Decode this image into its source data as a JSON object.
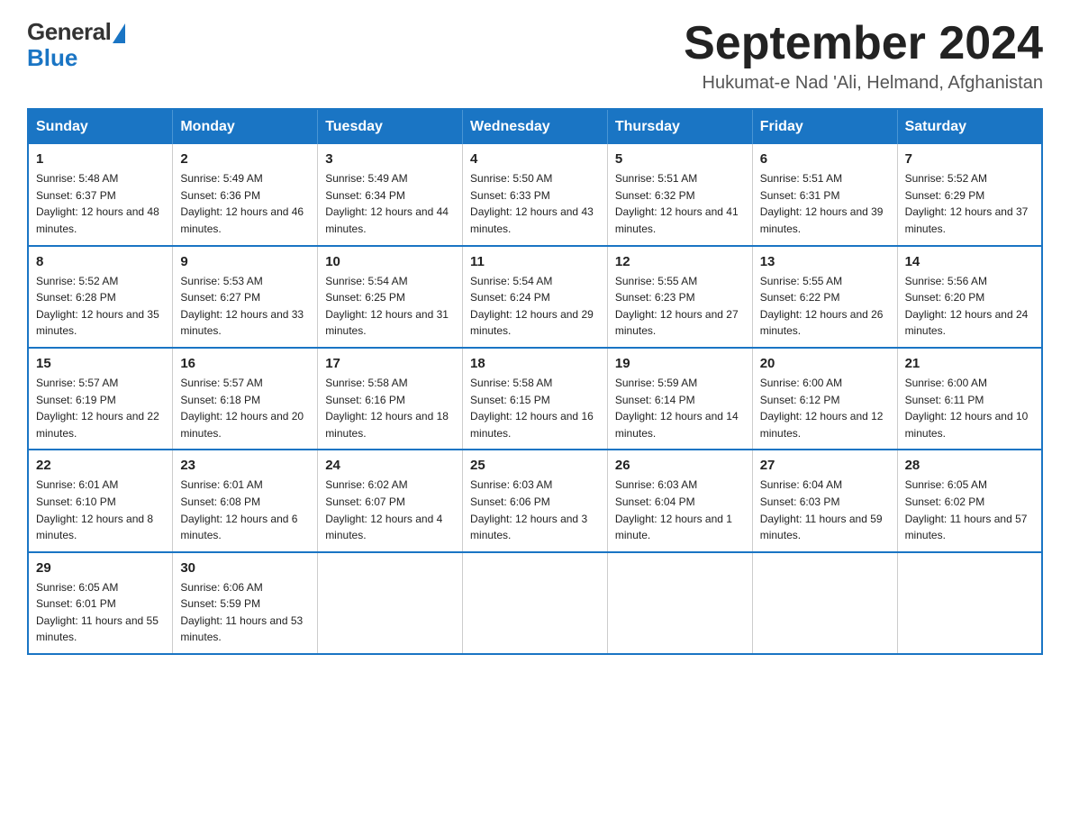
{
  "logo": {
    "general_text": "General",
    "blue_text": "Blue"
  },
  "title": {
    "month_year": "September 2024",
    "location": "Hukumat-e Nad 'Ali, Helmand, Afghanistan"
  },
  "weekdays": [
    "Sunday",
    "Monday",
    "Tuesday",
    "Wednesday",
    "Thursday",
    "Friday",
    "Saturday"
  ],
  "weeks": [
    [
      {
        "day": "1",
        "sunrise": "Sunrise: 5:48 AM",
        "sunset": "Sunset: 6:37 PM",
        "daylight": "Daylight: 12 hours and 48 minutes."
      },
      {
        "day": "2",
        "sunrise": "Sunrise: 5:49 AM",
        "sunset": "Sunset: 6:36 PM",
        "daylight": "Daylight: 12 hours and 46 minutes."
      },
      {
        "day": "3",
        "sunrise": "Sunrise: 5:49 AM",
        "sunset": "Sunset: 6:34 PM",
        "daylight": "Daylight: 12 hours and 44 minutes."
      },
      {
        "day": "4",
        "sunrise": "Sunrise: 5:50 AM",
        "sunset": "Sunset: 6:33 PM",
        "daylight": "Daylight: 12 hours and 43 minutes."
      },
      {
        "day": "5",
        "sunrise": "Sunrise: 5:51 AM",
        "sunset": "Sunset: 6:32 PM",
        "daylight": "Daylight: 12 hours and 41 minutes."
      },
      {
        "day": "6",
        "sunrise": "Sunrise: 5:51 AM",
        "sunset": "Sunset: 6:31 PM",
        "daylight": "Daylight: 12 hours and 39 minutes."
      },
      {
        "day": "7",
        "sunrise": "Sunrise: 5:52 AM",
        "sunset": "Sunset: 6:29 PM",
        "daylight": "Daylight: 12 hours and 37 minutes."
      }
    ],
    [
      {
        "day": "8",
        "sunrise": "Sunrise: 5:52 AM",
        "sunset": "Sunset: 6:28 PM",
        "daylight": "Daylight: 12 hours and 35 minutes."
      },
      {
        "day": "9",
        "sunrise": "Sunrise: 5:53 AM",
        "sunset": "Sunset: 6:27 PM",
        "daylight": "Daylight: 12 hours and 33 minutes."
      },
      {
        "day": "10",
        "sunrise": "Sunrise: 5:54 AM",
        "sunset": "Sunset: 6:25 PM",
        "daylight": "Daylight: 12 hours and 31 minutes."
      },
      {
        "day": "11",
        "sunrise": "Sunrise: 5:54 AM",
        "sunset": "Sunset: 6:24 PM",
        "daylight": "Daylight: 12 hours and 29 minutes."
      },
      {
        "day": "12",
        "sunrise": "Sunrise: 5:55 AM",
        "sunset": "Sunset: 6:23 PM",
        "daylight": "Daylight: 12 hours and 27 minutes."
      },
      {
        "day": "13",
        "sunrise": "Sunrise: 5:55 AM",
        "sunset": "Sunset: 6:22 PM",
        "daylight": "Daylight: 12 hours and 26 minutes."
      },
      {
        "day": "14",
        "sunrise": "Sunrise: 5:56 AM",
        "sunset": "Sunset: 6:20 PM",
        "daylight": "Daylight: 12 hours and 24 minutes."
      }
    ],
    [
      {
        "day": "15",
        "sunrise": "Sunrise: 5:57 AM",
        "sunset": "Sunset: 6:19 PM",
        "daylight": "Daylight: 12 hours and 22 minutes."
      },
      {
        "day": "16",
        "sunrise": "Sunrise: 5:57 AM",
        "sunset": "Sunset: 6:18 PM",
        "daylight": "Daylight: 12 hours and 20 minutes."
      },
      {
        "day": "17",
        "sunrise": "Sunrise: 5:58 AM",
        "sunset": "Sunset: 6:16 PM",
        "daylight": "Daylight: 12 hours and 18 minutes."
      },
      {
        "day": "18",
        "sunrise": "Sunrise: 5:58 AM",
        "sunset": "Sunset: 6:15 PM",
        "daylight": "Daylight: 12 hours and 16 minutes."
      },
      {
        "day": "19",
        "sunrise": "Sunrise: 5:59 AM",
        "sunset": "Sunset: 6:14 PM",
        "daylight": "Daylight: 12 hours and 14 minutes."
      },
      {
        "day": "20",
        "sunrise": "Sunrise: 6:00 AM",
        "sunset": "Sunset: 6:12 PM",
        "daylight": "Daylight: 12 hours and 12 minutes."
      },
      {
        "day": "21",
        "sunrise": "Sunrise: 6:00 AM",
        "sunset": "Sunset: 6:11 PM",
        "daylight": "Daylight: 12 hours and 10 minutes."
      }
    ],
    [
      {
        "day": "22",
        "sunrise": "Sunrise: 6:01 AM",
        "sunset": "Sunset: 6:10 PM",
        "daylight": "Daylight: 12 hours and 8 minutes."
      },
      {
        "day": "23",
        "sunrise": "Sunrise: 6:01 AM",
        "sunset": "Sunset: 6:08 PM",
        "daylight": "Daylight: 12 hours and 6 minutes."
      },
      {
        "day": "24",
        "sunrise": "Sunrise: 6:02 AM",
        "sunset": "Sunset: 6:07 PM",
        "daylight": "Daylight: 12 hours and 4 minutes."
      },
      {
        "day": "25",
        "sunrise": "Sunrise: 6:03 AM",
        "sunset": "Sunset: 6:06 PM",
        "daylight": "Daylight: 12 hours and 3 minutes."
      },
      {
        "day": "26",
        "sunrise": "Sunrise: 6:03 AM",
        "sunset": "Sunset: 6:04 PM",
        "daylight": "Daylight: 12 hours and 1 minute."
      },
      {
        "day": "27",
        "sunrise": "Sunrise: 6:04 AM",
        "sunset": "Sunset: 6:03 PM",
        "daylight": "Daylight: 11 hours and 59 minutes."
      },
      {
        "day": "28",
        "sunrise": "Sunrise: 6:05 AM",
        "sunset": "Sunset: 6:02 PM",
        "daylight": "Daylight: 11 hours and 57 minutes."
      }
    ],
    [
      {
        "day": "29",
        "sunrise": "Sunrise: 6:05 AM",
        "sunset": "Sunset: 6:01 PM",
        "daylight": "Daylight: 11 hours and 55 minutes."
      },
      {
        "day": "30",
        "sunrise": "Sunrise: 6:06 AM",
        "sunset": "Sunset: 5:59 PM",
        "daylight": "Daylight: 11 hours and 53 minutes."
      },
      null,
      null,
      null,
      null,
      null
    ]
  ]
}
